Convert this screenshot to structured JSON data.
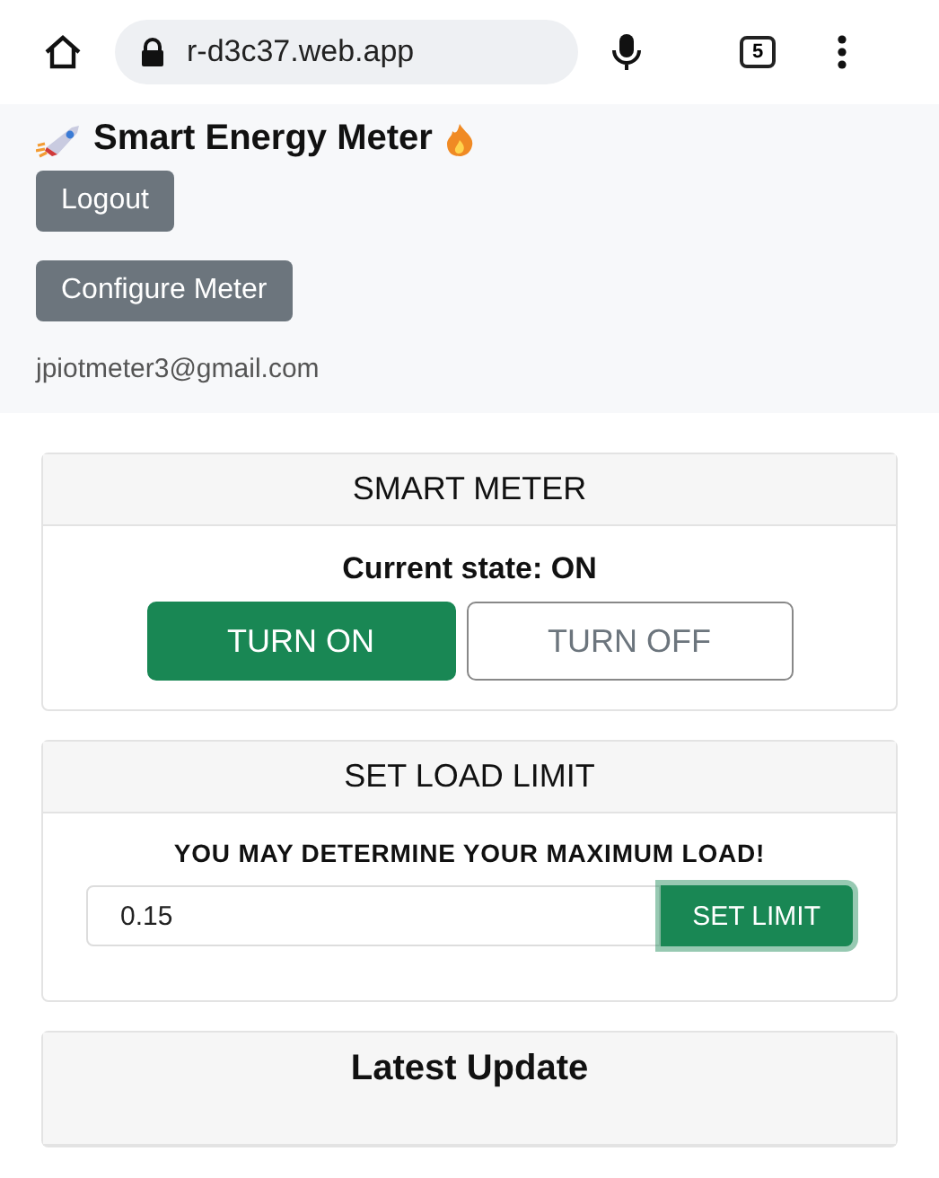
{
  "browser": {
    "url": "r-d3c37.web.app",
    "tab_count": "5"
  },
  "header": {
    "title": "Smart Energy Meter",
    "buttons": [
      "Logout",
      "Configure Meter"
    ],
    "email": "jpiotmeter3@gmail.com"
  },
  "meter_card": {
    "title": "SMART METER",
    "state_text": "Current state: ON",
    "toggles": [
      {
        "label": "TURN ON",
        "selected": true
      },
      {
        "label": "TURN OFF",
        "selected": false
      }
    ]
  },
  "limit_card": {
    "title": "SET LOAD LIMIT",
    "prompt": "YOU MAY DETERMINE YOUR MAXIMUM LOAD!",
    "value": "0.15",
    "button": {
      "label": "SET LIMIT",
      "focused": true
    }
  },
  "update_card": {
    "title": "Latest Update"
  }
}
